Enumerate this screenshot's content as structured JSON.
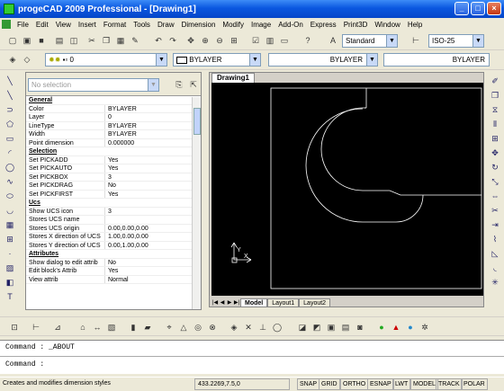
{
  "window": {
    "title": "progeCAD 2009 Professional - [Drawing1]",
    "min": "_",
    "max": "□",
    "close": "×"
  },
  "menu": [
    "File",
    "Edit",
    "View",
    "Insert",
    "Format",
    "Tools",
    "Draw",
    "Dimension",
    "Modify",
    "Image",
    "Add-On",
    "Express",
    "Print3D",
    "Window",
    "Help"
  ],
  "toolbar": {
    "textstyle": "Standard",
    "dimstyle": "ISO-25",
    "layer": "0",
    "color": "BYLAYER",
    "linetype": "BYLAYER",
    "lineweight": "BYLAYER"
  },
  "properties": {
    "selection_combo": "No selection",
    "rows": [
      {
        "k": "General",
        "v": "",
        "section": true
      },
      {
        "k": "Color",
        "v": "BYLAYER"
      },
      {
        "k": "Layer",
        "v": "0"
      },
      {
        "k": "LineType",
        "v": "BYLAYER"
      },
      {
        "k": "Width",
        "v": "BYLAYER"
      },
      {
        "k": "Point dimension",
        "v": "0.000000"
      },
      {
        "k": "Selection",
        "v": "",
        "section": true
      },
      {
        "k": "Set PICKADD",
        "v": "Yes"
      },
      {
        "k": "Set PICKAUTO",
        "v": "Yes"
      },
      {
        "k": "Set PICKBOX",
        "v": "3"
      },
      {
        "k": "Set PICKDRAG",
        "v": "No"
      },
      {
        "k": "Set PICKFIRST",
        "v": "Yes"
      },
      {
        "k": "Ucs",
        "v": "",
        "section": true
      },
      {
        "k": "Show UCS icon",
        "v": "3"
      },
      {
        "k": "Stores UCS name",
        "v": ""
      },
      {
        "k": "Stores UCS origin",
        "v": "0.00,0.00,0.00"
      },
      {
        "k": "Stores X direction of UCS",
        "v": "1.00,0.00,0.00"
      },
      {
        "k": "Stores Y direction of UCS",
        "v": "0.00,1.00,0.00"
      },
      {
        "k": "Attributes",
        "v": "",
        "section": true
      },
      {
        "k": "Show dialog to edit attrib",
        "v": "No"
      },
      {
        "k": "Edit block's Attrib",
        "v": "Yes"
      },
      {
        "k": "View attrib",
        "v": "Normal"
      }
    ]
  },
  "drawing": {
    "tab": "Drawing1",
    "layouts": [
      "Model",
      "Layout1",
      "Layout2"
    ],
    "ucs_x": "X",
    "ucs_y": "Y"
  },
  "command": {
    "history": "Command : _ABOUT",
    "prompt": "Command :"
  },
  "status": {
    "message": "Creates and modifies dimension styles",
    "coords": "433.2269,7.5,0",
    "buttons": [
      "SNAP",
      "GRID",
      "ORTHO",
      "ESNAP",
      "LWT",
      "MODEL",
      "TRACK",
      "POLAR"
    ]
  },
  "colors": {
    "titlebar": "#0a57e0",
    "canvas": "#000000",
    "lines": "#ffffff"
  }
}
